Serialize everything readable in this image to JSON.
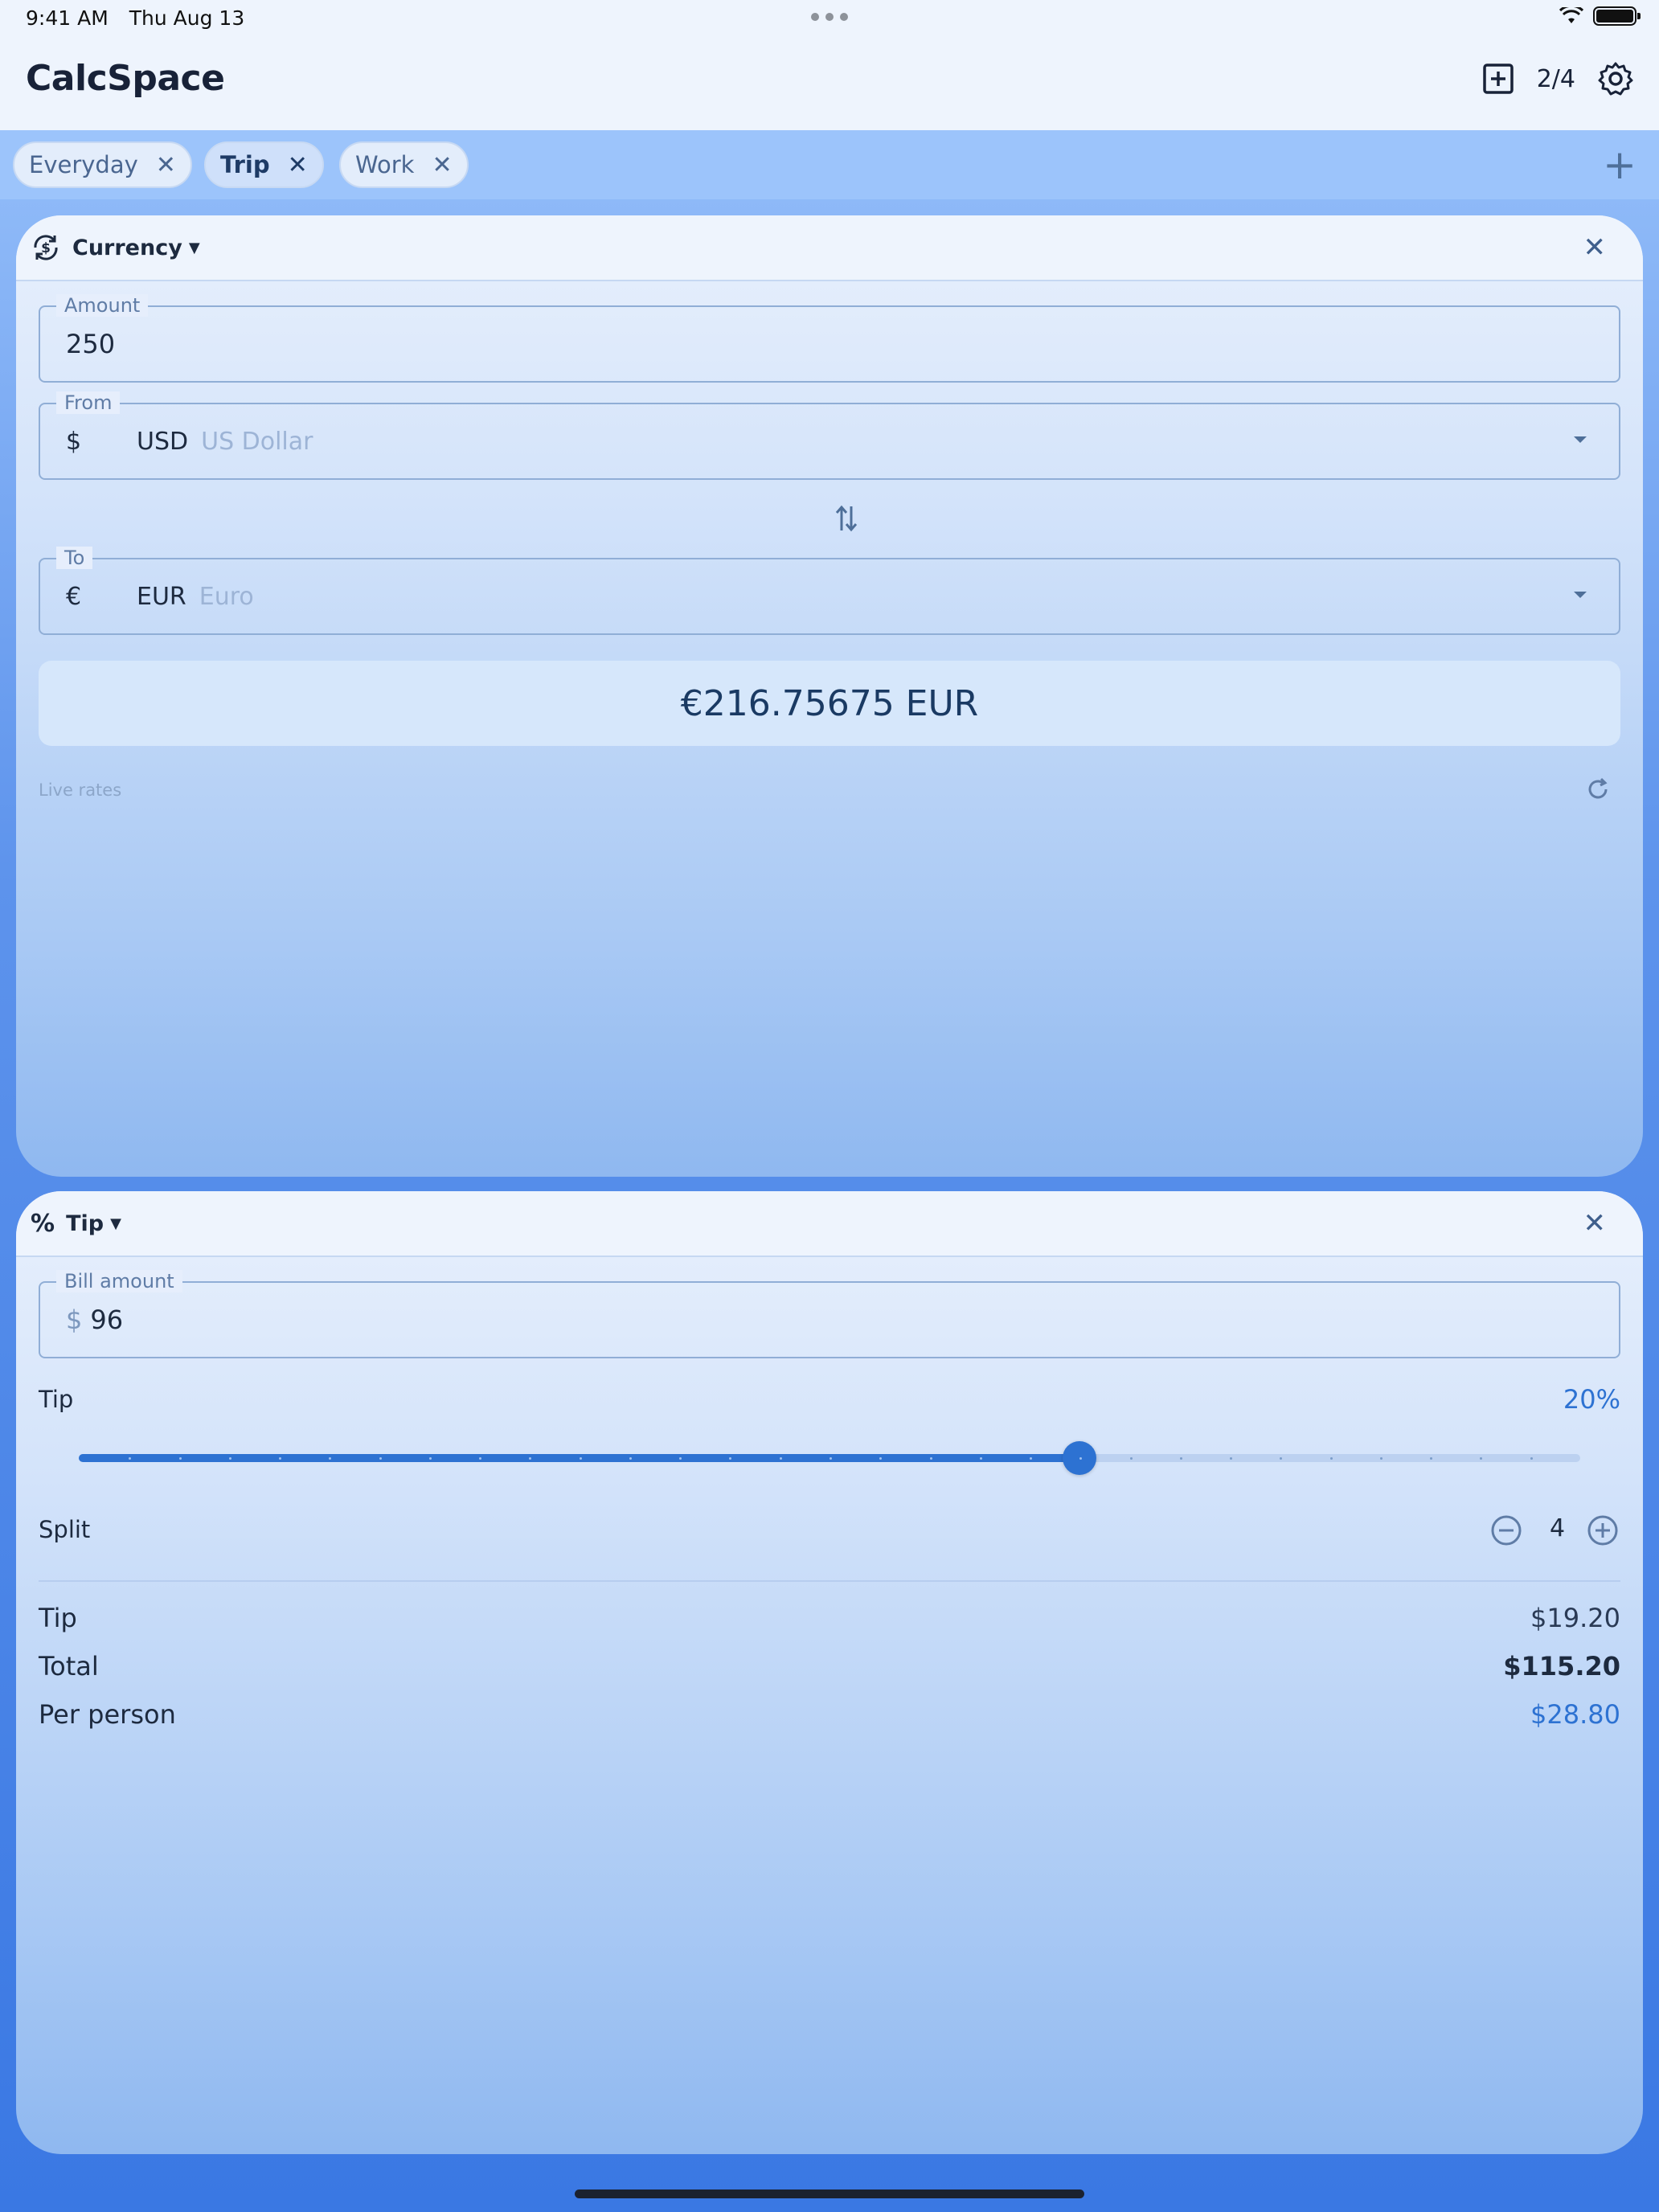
{
  "status": {
    "time": "9:41 AM",
    "date": "Thu Aug 13"
  },
  "header": {
    "title": "CalcSpace",
    "count": "2/4"
  },
  "tabs": [
    {
      "label": "Everyday",
      "active": false
    },
    {
      "label": "Trip",
      "active": true
    },
    {
      "label": "Work",
      "active": false
    }
  ],
  "currency": {
    "title": "Currency",
    "amount_label": "Amount",
    "amount": "250",
    "from_label": "From",
    "from_symbol": "$",
    "from_code": "USD",
    "from_name": "US Dollar",
    "to_label": "To",
    "to_symbol": "€",
    "to_code": "EUR",
    "to_name": "Euro",
    "result": "€216.75675 EUR",
    "live_rates": "Live rates"
  },
  "tip": {
    "title": "Tip",
    "bill_label": "Bill amount",
    "bill_symbol": "$",
    "bill": "96",
    "tip_label": "Tip",
    "tip_percent": "20%",
    "slider_fraction": 0.6667,
    "split_label": "Split",
    "split": "4",
    "rows": [
      {
        "label": "Tip",
        "value": "$19.20"
      },
      {
        "label": "Total",
        "value": "$115.20"
      },
      {
        "label": "Per person",
        "value": "$28.80"
      }
    ]
  },
  "colors": {
    "accent": "#2d72d2",
    "background": "#3a78e3"
  }
}
